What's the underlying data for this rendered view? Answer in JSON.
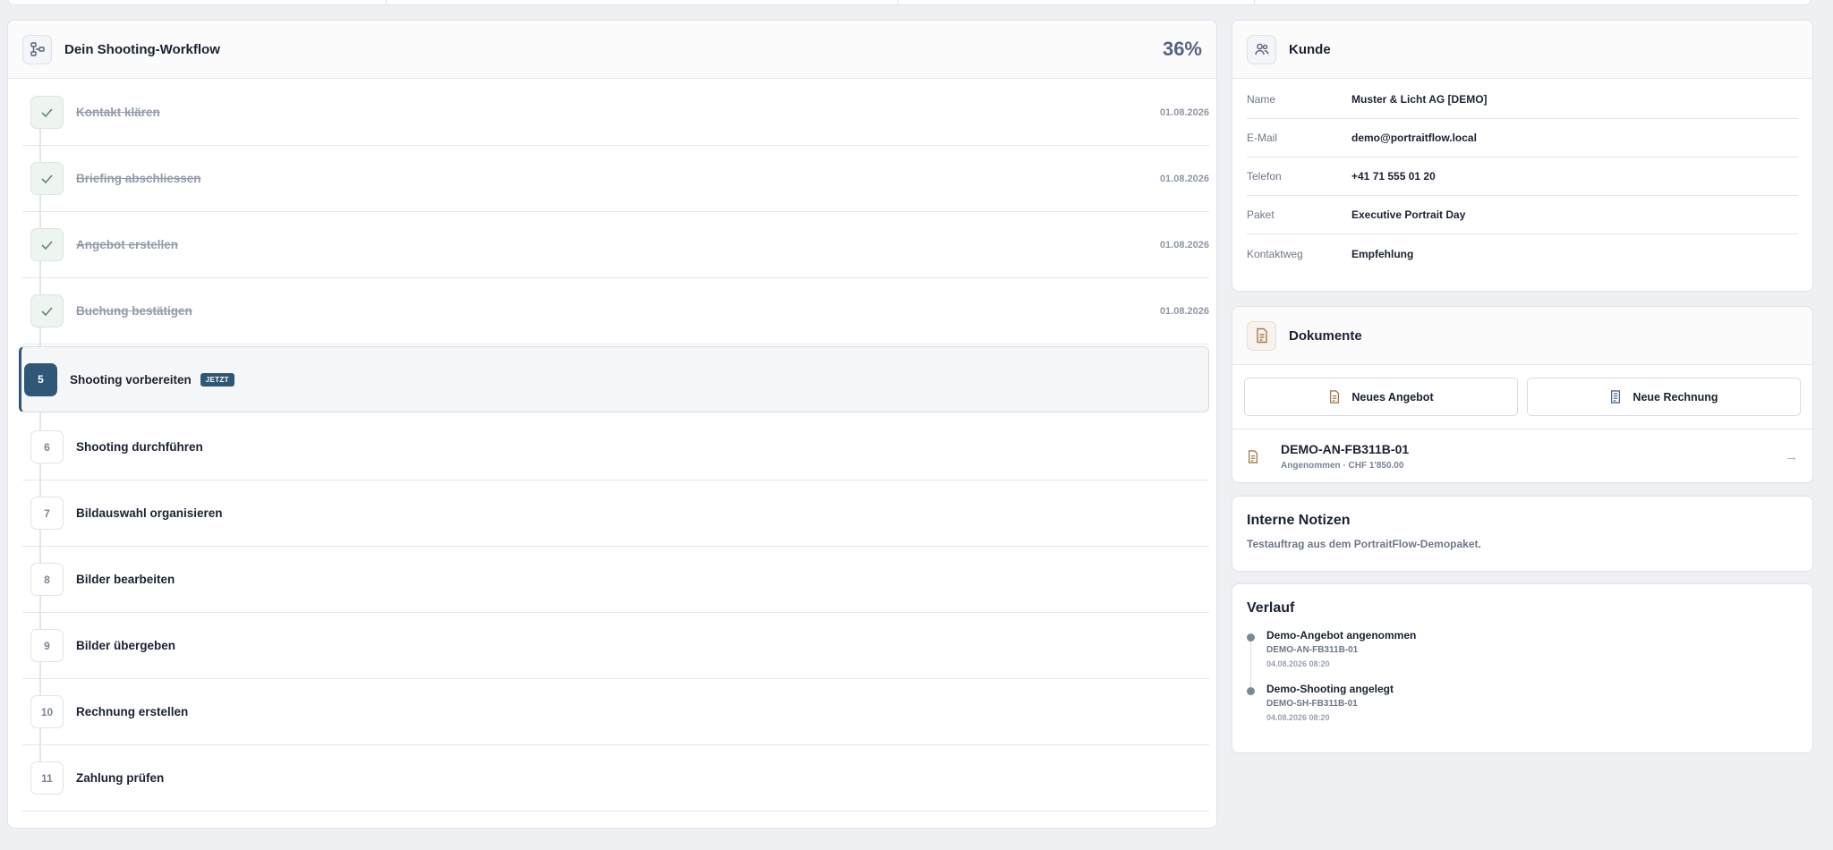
{
  "workflow": {
    "title": "Dein Shooting-Workflow",
    "progress": "36%",
    "steps": [
      {
        "num": "✓",
        "label": "Kontakt klären",
        "date": "01.08.2026",
        "status": "done"
      },
      {
        "num": "✓",
        "label": "Briefing abschliessen",
        "date": "01.08.2026",
        "status": "done"
      },
      {
        "num": "✓",
        "label": "Angebot erstellen",
        "date": "01.08.2026",
        "status": "done"
      },
      {
        "num": "✓",
        "label": "Buchung bestätigen",
        "date": "01.08.2026",
        "status": "done"
      },
      {
        "num": "5",
        "label": "Shooting vorbereiten",
        "date": "",
        "status": "current",
        "badge": "JETZT"
      },
      {
        "num": "6",
        "label": "Shooting durchführen",
        "date": "",
        "status": "open"
      },
      {
        "num": "7",
        "label": "Bildauswahl organisieren",
        "date": "",
        "status": "open"
      },
      {
        "num": "8",
        "label": "Bilder bearbeiten",
        "date": "",
        "status": "open"
      },
      {
        "num": "9",
        "label": "Bilder übergeben",
        "date": "",
        "status": "open"
      },
      {
        "num": "10",
        "label": "Rechnung erstellen",
        "date": "",
        "status": "open"
      },
      {
        "num": "11",
        "label": "Zahlung prüfen",
        "date": "",
        "status": "open"
      }
    ]
  },
  "kunde": {
    "title": "Kunde",
    "fields": [
      {
        "key": "Name",
        "value": "Muster & Licht AG [DEMO]"
      },
      {
        "key": "E-Mail",
        "value": "demo@portraitflow.local"
      },
      {
        "key": "Telefon",
        "value": "+41 71 555 01 20"
      },
      {
        "key": "Paket",
        "value": "Executive Portrait Day"
      },
      {
        "key": "Kontaktweg",
        "value": "Empfehlung"
      }
    ]
  },
  "dokumente": {
    "title": "Dokumente",
    "new_offer": "Neues Angebot",
    "new_invoice": "Neue Rechnung",
    "item": {
      "ref": "DEMO-AN-FB311B-01",
      "sub": "Angenommen · CHF 1'850.00"
    }
  },
  "notizen": {
    "title": "Interne Notizen",
    "text": "Testauftrag aus dem PortraitFlow-Demopaket."
  },
  "verlauf": {
    "title": "Verlauf",
    "items": [
      {
        "title": "Demo-Angebot angenommen",
        "ref": "DEMO-AN-FB311B-01",
        "time": "04.08.2026 08:20"
      },
      {
        "title": "Demo-Shooting angelegt",
        "ref": "DEMO-SH-FB311B-01",
        "time": "04.08.2026 08:20"
      }
    ]
  },
  "colors": {
    "accent": "#2f5878",
    "done_bg": "#eef5f0",
    "check": "#5e8a6e",
    "doc_icon": "#a47a4e",
    "invoice_icon": "#4c6a8e"
  },
  "icons": {
    "workflow": "workflow-icon",
    "kunde": "users-icon",
    "doc": "document-icon",
    "arrow": "arrow-right-icon"
  }
}
